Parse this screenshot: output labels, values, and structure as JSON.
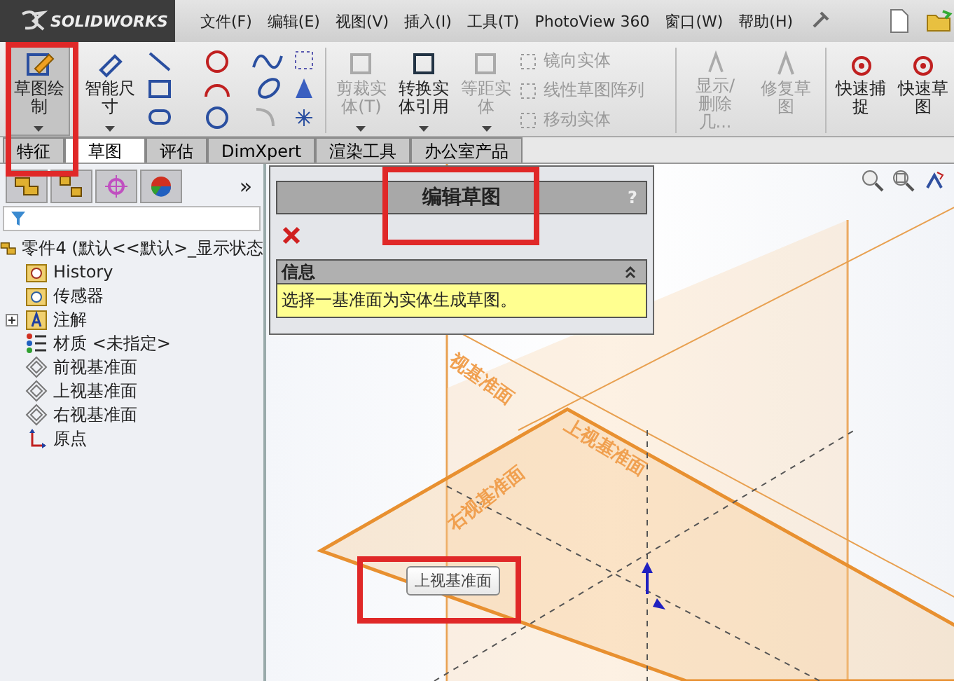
{
  "app": {
    "logo_text": "SOLIDWORKS"
  },
  "menu": [
    {
      "label": "文件(F)"
    },
    {
      "label": "编辑(E)"
    },
    {
      "label": "视图(V)"
    },
    {
      "label": "插入(I)"
    },
    {
      "label": "工具(T)"
    },
    {
      "label": "PhotoView 360"
    },
    {
      "label": "窗口(W)"
    },
    {
      "label": "帮助(H)"
    }
  ],
  "toolbar": {
    "sketch_buttons": [
      {
        "label": "草图绘制",
        "on": true
      },
      {
        "label": "智能尺寸",
        "on": false
      }
    ],
    "edit_buttons": [
      {
        "label": "剪裁实体(T)",
        "disabled": true
      },
      {
        "label": "转换实体引用",
        "disabled": false
      },
      {
        "label": "等距实体",
        "disabled": true
      }
    ],
    "entity_commands": [
      {
        "label": "镜向实体",
        "disabled": true
      },
      {
        "label": "线性草图阵列",
        "disabled": true
      },
      {
        "label": "移动实体",
        "disabled": true
      }
    ],
    "relation_buttons": [
      {
        "label": "显示/删除几...",
        "disabled": true
      },
      {
        "label": "修复草图",
        "disabled": true
      }
    ],
    "snap_buttons": [
      {
        "label": "快速捕捉",
        "disabled": false
      },
      {
        "label": "快速草图",
        "disabled": false
      }
    ]
  },
  "tabs": [
    {
      "label": "特征",
      "selected": false
    },
    {
      "label": "草图",
      "selected": true
    },
    {
      "label": "评估",
      "selected": false
    },
    {
      "label": "DimXpert",
      "selected": false
    },
    {
      "label": "渲染工具",
      "selected": false
    },
    {
      "label": "办公室产品",
      "selected": false
    }
  ],
  "feature_tree": {
    "root": "零件4 (默认<<默认>_显示状态",
    "children": [
      {
        "kind": "history",
        "label": "History"
      },
      {
        "kind": "sensor",
        "label": "传感器"
      },
      {
        "kind": "annotation",
        "label": "注解",
        "expanded": false
      },
      {
        "kind": "material",
        "label": "材质 <未指定>"
      },
      {
        "kind": "plane",
        "label": "前视基准面"
      },
      {
        "kind": "plane",
        "label": "上视基准面"
      },
      {
        "kind": "plane",
        "label": "右视基准面"
      },
      {
        "kind": "origin",
        "label": "原点"
      }
    ]
  },
  "panel_tabs_more": "»",
  "property_manager": {
    "title": "编辑草图",
    "help": "?",
    "info_title": "信息",
    "info_text": "选择一基准面为实体生成草图。"
  },
  "viewport": {
    "plane_labels": [
      {
        "text": "视基准面"
      },
      {
        "text": "上视基准面"
      },
      {
        "text": "右视基准面"
      }
    ],
    "tooltip": "上视基准面"
  }
}
